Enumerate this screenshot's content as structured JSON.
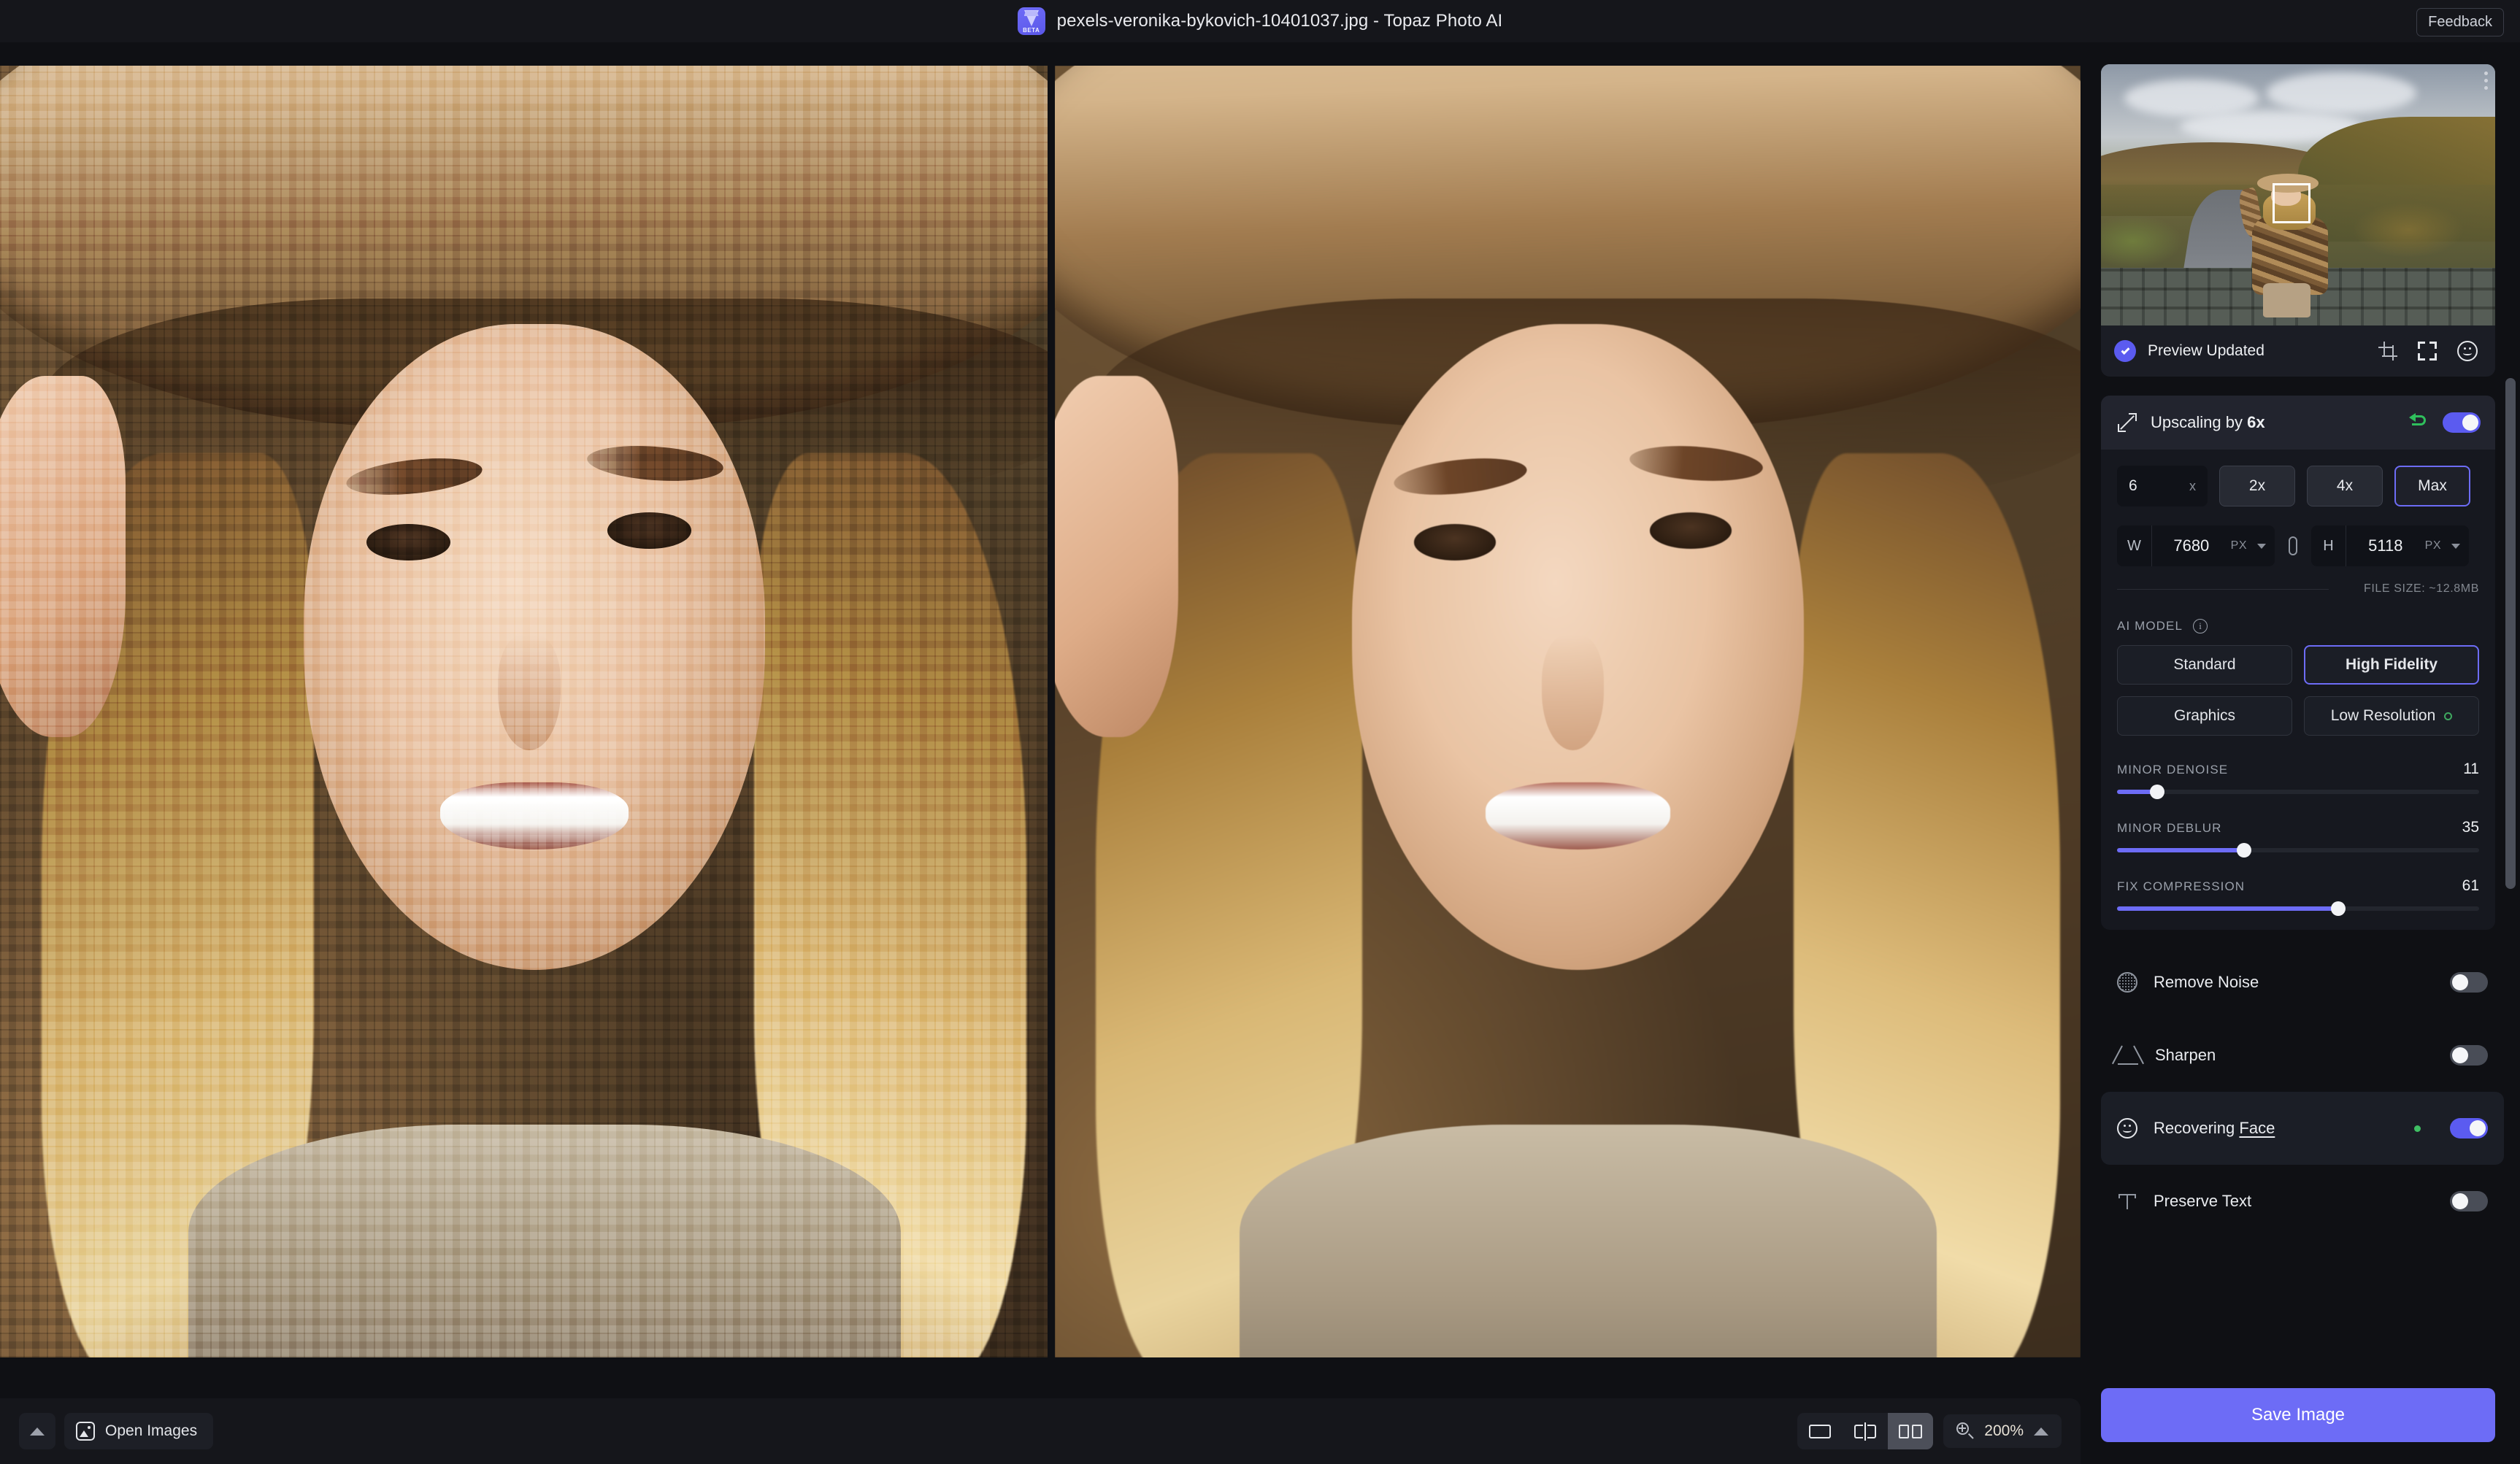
{
  "titlebar": {
    "app_icon_badge": "BETA",
    "title": "pexels-veronika-bykovich-10401037.jpg - Topaz Photo AI",
    "feedback_label": "Feedback"
  },
  "preview": {
    "status_label": "Preview Updated",
    "tools": [
      "crop-icon",
      "fullscreen-icon",
      "face-icon"
    ],
    "overflow_menu": "more-options-icon",
    "face_selection_box": true
  },
  "upscaling": {
    "title_prefix": "Upscaling by ",
    "title_value": "6x",
    "enabled": true,
    "undo_available": true,
    "scale_input_value": "6",
    "scale_input_unit": "x",
    "scale_presets": [
      {
        "label": "2x",
        "selected": false
      },
      {
        "label": "4x",
        "selected": false
      },
      {
        "label": "Max",
        "selected": true
      }
    ],
    "width": {
      "label": "W",
      "value": "7680",
      "unit": "PX"
    },
    "height": {
      "label": "H",
      "value": "5118",
      "unit": "PX"
    },
    "link_aspect": true,
    "file_size": "FILE SIZE: ~12.8MB",
    "ai_model_label": "AI MODEL",
    "models": [
      {
        "label": "Standard",
        "selected": false,
        "dot": false
      },
      {
        "label": "High Fidelity",
        "selected": true,
        "dot": false
      },
      {
        "label": "Graphics",
        "selected": false,
        "dot": false
      },
      {
        "label": "Low Resolution",
        "selected": false,
        "dot": true
      }
    ],
    "sliders": [
      {
        "name": "MINOR DENOISE",
        "value": 11,
        "max": 100
      },
      {
        "name": "MINOR DEBLUR",
        "value": 35,
        "max": 100
      },
      {
        "name": "FIX COMPRESSION",
        "value": 61,
        "max": 100
      }
    ]
  },
  "tools": [
    {
      "name": "Remove Noise",
      "icon": "noise-icon",
      "enabled": false,
      "dot": false,
      "active": false,
      "underline": ""
    },
    {
      "name": "Sharpen",
      "icon": "sharpen-icon",
      "enabled": false,
      "dot": false,
      "active": false,
      "underline": ""
    },
    {
      "name": "Recovering ",
      "icon": "face-icon",
      "enabled": true,
      "dot": true,
      "active": true,
      "underline": "Face"
    },
    {
      "name": "Preserve Text",
      "icon": "text-icon",
      "enabled": false,
      "dot": false,
      "active": false,
      "underline": ""
    }
  ],
  "save": {
    "label": "Save Image"
  },
  "bottombar": {
    "collapse_label": "chevron-up-icon",
    "open_images_label": "Open Images",
    "view_modes": [
      {
        "icon": "single-view-icon",
        "selected": false
      },
      {
        "icon": "split-view-icon",
        "selected": false
      },
      {
        "icon": "side-by-side-view-icon",
        "selected": true
      }
    ],
    "zoom_label": "200%",
    "zoom_icon": "magnifier-plus-icon",
    "zoom_chevron": "chevron-up-icon"
  },
  "colors": {
    "accent": "#6d6cf6",
    "accent_check": "#5b5bf0",
    "green": "#3fbf63",
    "undo_green": "#2fbf5c",
    "panel_bg": "#0f1014",
    "card_bg": "#16181f",
    "card_head_bg": "#22242e",
    "zoom_text": "#e8e2d6"
  }
}
